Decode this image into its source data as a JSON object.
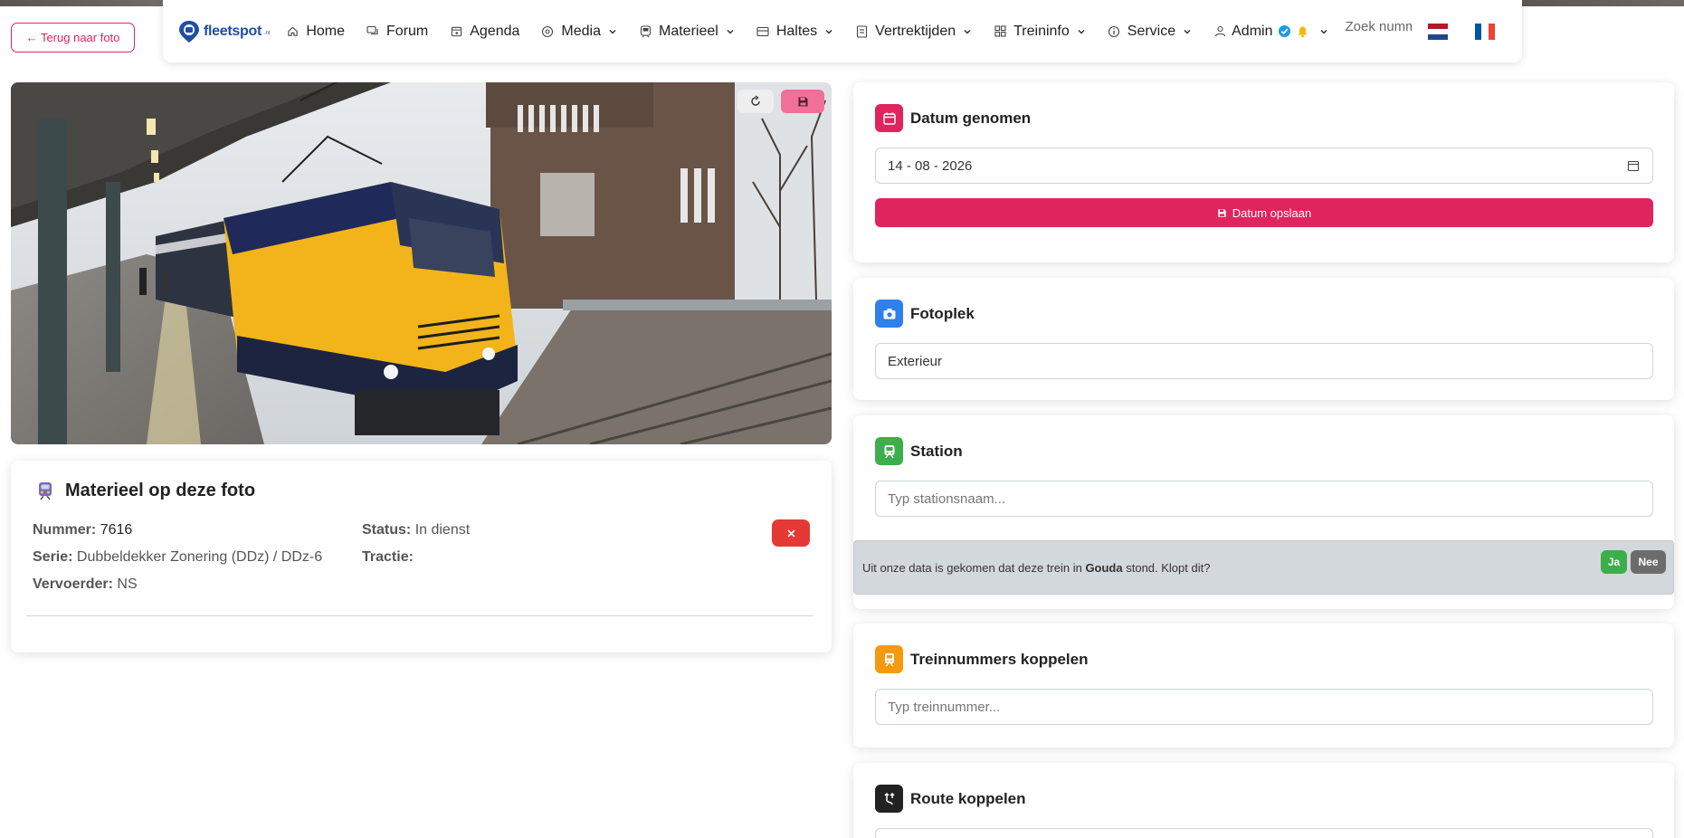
{
  "back_button": {
    "label": "← Terug naar foto"
  },
  "navbar": {
    "logo_text": "fleetspot",
    "logo_suffix": ".nl",
    "items": [
      {
        "label": "Home",
        "icon": "home-icon"
      },
      {
        "label": "Forum",
        "icon": "chat-icon"
      },
      {
        "label": "Agenda",
        "icon": "calendar-icon"
      },
      {
        "label": "Media",
        "icon": "media-icon"
      },
      {
        "label": "Materieel",
        "icon": "train-icon"
      },
      {
        "label": "Haltes",
        "icon": "stop-icon"
      },
      {
        "label": "Vertrektijden",
        "icon": "list-icon"
      },
      {
        "label": "Treininfo",
        "icon": "grid-icon"
      },
      {
        "label": "Service",
        "icon": "info-icon"
      },
      {
        "label": "Admin",
        "icon": "user-icon"
      }
    ],
    "search_placeholder": "Zoek numm",
    "languages": [
      "nl-flag-icon",
      "fr-flag-icon"
    ]
  },
  "photo": {
    "refresh_icon": "refresh-icon",
    "save_icon": "save-icon"
  },
  "materieel": {
    "title": "Materieel op deze foto",
    "fields": {
      "nummer_label": "Nummer:",
      "nummer": "7616",
      "serie_label": "Serie:",
      "serie": "Dubbeldekker Zonering (DDz) / DDz-6",
      "vervoerder_label": "Vervoerder:",
      "vervoerder": "NS",
      "status_label": "Status:",
      "status": "In dienst",
      "tractie_label": "Tractie:",
      "tractie": ""
    },
    "delete_icon": "close-icon"
  },
  "datum": {
    "title": "Datum genomen",
    "value": "14 - 08 - 2026",
    "save_label": "Datum opslaan",
    "color": "#e0245e"
  },
  "fotoplek": {
    "title": "Fotoplek",
    "value": "Exterieur",
    "color": "#2f80ed"
  },
  "station": {
    "title": "Station",
    "placeholder": "Typ stationsnaam...",
    "color": "#3cae4a",
    "suggestion_before": "Uit onze data is gekomen dat deze trein in ",
    "suggestion_station": "Gouda",
    "suggestion_after": " stond. Klopt dit?",
    "yes_label": "Ja",
    "no_label": "Nee"
  },
  "treinnummers": {
    "title": "Treinnummers koppelen",
    "placeholder": "Typ treinnummer...",
    "color": "#f59a0c"
  },
  "route": {
    "title": "Route koppelen",
    "color": "#222222"
  }
}
